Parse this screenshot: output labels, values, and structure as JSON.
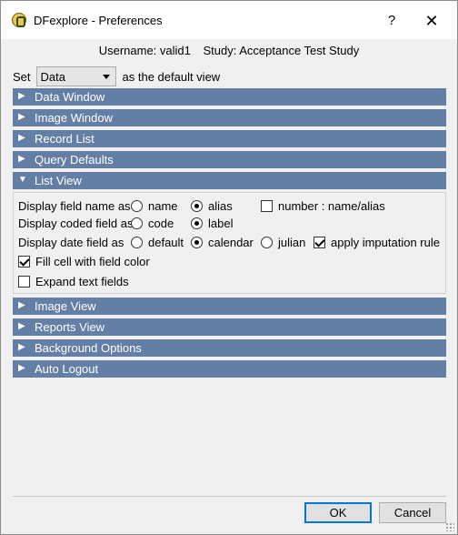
{
  "window": {
    "title": "DFexplore - Preferences",
    "help_symbol": "?",
    "close_symbol": "✕",
    "icon": "dfexplore-app-icon"
  },
  "user_info": {
    "username": "Username: valid1",
    "study": "Study: Acceptance Test Study"
  },
  "default_view": {
    "prefix": "Set",
    "selected": "Data",
    "suffix": "as the default view"
  },
  "sections_top": [
    {
      "label": "Data Window",
      "expanded": false
    },
    {
      "label": "Image Window",
      "expanded": false
    },
    {
      "label": "Record List",
      "expanded": false
    },
    {
      "label": "Query Defaults",
      "expanded": false
    },
    {
      "label": "List View",
      "expanded": true
    }
  ],
  "list_view": {
    "field_name": {
      "label": "Display field name as",
      "options": [
        "name",
        "alias"
      ],
      "selected": "alias",
      "extra_checkbox": {
        "label": "number : name/alias",
        "checked": false
      }
    },
    "coded_field": {
      "label": "Display coded field as",
      "options": [
        "code",
        "label"
      ],
      "selected": "label"
    },
    "date_field": {
      "label": "Display date field as",
      "options": [
        "default",
        "calendar",
        "julian"
      ],
      "selected": "calendar",
      "extra_checkbox": {
        "label": "apply imputation rule",
        "checked": true
      }
    },
    "fill_cell": {
      "label": "Fill cell with field color",
      "checked": true
    },
    "expand_text": {
      "label": "Expand text fields",
      "checked": false
    }
  },
  "sections_bottom": [
    {
      "label": "Image View",
      "expanded": false
    },
    {
      "label": "Reports View",
      "expanded": false
    },
    {
      "label": "Background Options",
      "expanded": false
    },
    {
      "label": "Auto Logout",
      "expanded": false
    }
  ],
  "arrows": {
    "collapsed": "▶",
    "expanded": "▼"
  },
  "buttons": {
    "ok": "OK",
    "cancel": "Cancel"
  },
  "colors": {
    "section_header": "#647fa5",
    "default_button_border": "#0078d7"
  }
}
